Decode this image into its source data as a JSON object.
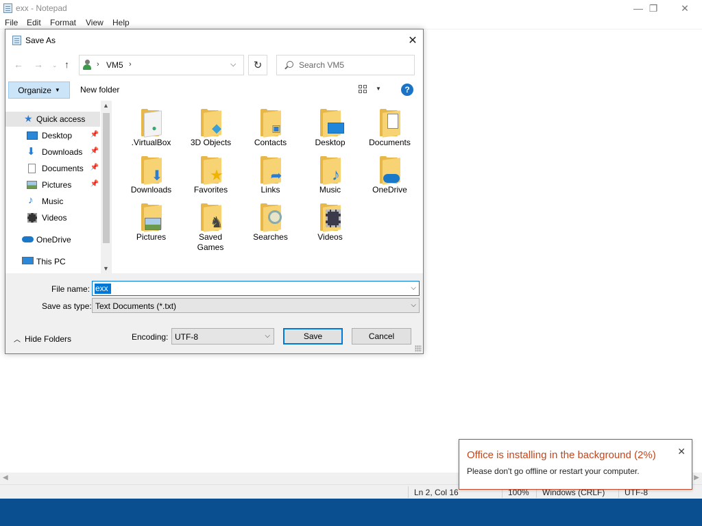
{
  "notepad": {
    "title": "exx - Notepad",
    "menus": [
      "File",
      "Edit",
      "Format",
      "View",
      "Help"
    ],
    "window_buttons": {
      "minimize": "—",
      "maximize": "❐",
      "close": "✕"
    },
    "status": {
      "position": "Ln 2, Col 16",
      "zoom": "100%",
      "line_ending": "Windows (CRLF)",
      "encoding": "UTF-8"
    }
  },
  "dialog": {
    "title": "Save As",
    "close_glyph": "✕",
    "address": {
      "crumb": "VM5",
      "separator": "›",
      "dropdown_glyph": "⌵"
    },
    "search": {
      "placeholder": "Search VM5"
    },
    "toolbar": {
      "organize_label": "Organize",
      "new_folder_label": "New folder",
      "help_glyph": "?"
    },
    "nav_items": [
      {
        "label": "Quick access",
        "icon": "star-icon",
        "pinned": false
      },
      {
        "label": "Desktop",
        "icon": "desktop-icon",
        "pinned": true
      },
      {
        "label": "Downloads",
        "icon": "download-icon",
        "pinned": true
      },
      {
        "label": "Documents",
        "icon": "document-icon",
        "pinned": true
      },
      {
        "label": "Pictures",
        "icon": "picture-icon",
        "pinned": true
      },
      {
        "label": "Music",
        "icon": "music-icon",
        "pinned": false
      },
      {
        "label": "Videos",
        "icon": "video-icon",
        "pinned": false
      },
      {
        "label": "OneDrive",
        "icon": "cloud-icon",
        "pinned": false
      },
      {
        "label": "This PC",
        "icon": "computer-icon",
        "pinned": false
      }
    ],
    "folders": [
      {
        "label": ".VirtualBox"
      },
      {
        "label": "3D Objects"
      },
      {
        "label": "Contacts"
      },
      {
        "label": "Desktop"
      },
      {
        "label": "Documents"
      },
      {
        "label": "Downloads"
      },
      {
        "label": "Favorites"
      },
      {
        "label": "Links"
      },
      {
        "label": "Music"
      },
      {
        "label": "OneDrive"
      },
      {
        "label": "Pictures"
      },
      {
        "label": "Saved Games"
      },
      {
        "label": "Searches"
      },
      {
        "label": "Videos"
      }
    ],
    "file_name_label": "File name:",
    "file_name_value": "exx",
    "save_type_label": "Save as type:",
    "save_type_value": "Text Documents (*.txt)",
    "hide_folders_label": "Hide Folders",
    "encoding_label": "Encoding:",
    "encoding_value": "UTF-8",
    "save_label": "Save",
    "cancel_label": "Cancel"
  },
  "toast": {
    "title": "Office is installing in the background (2%)",
    "body": "Please don't go offline or restart your computer.",
    "close_glyph": "✕",
    "accent": "#c0461e"
  },
  "colors": {
    "taskbar": "#0a5090",
    "selection": "#0078d7",
    "folder": "#f7d374"
  }
}
